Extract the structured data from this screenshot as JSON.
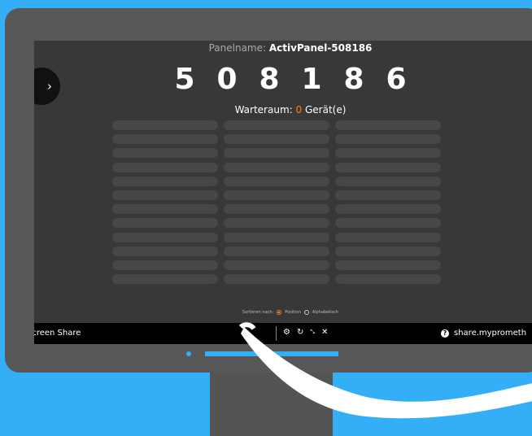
{
  "panel": {
    "label": "Panelname:",
    "name": "ActivPanel-508186",
    "digits": [
      "5",
      "0",
      "8",
      "1",
      "8",
      "6"
    ],
    "waiting_label": "Warteraum:",
    "waiting_count": "0",
    "waiting_unit": "Gerät(e)"
  },
  "sort": {
    "label": "Sortieren nach:",
    "options": [
      "Position",
      "Alphabetisch"
    ],
    "selected": "Position"
  },
  "taskbar": {
    "app_title": "Screen Share",
    "controls": [
      "gear-icon",
      "refresh-icon",
      "shrink-icon",
      "close-icon"
    ],
    "url": "share.myprometh"
  },
  "colors": {
    "background": "#33aef7",
    "accent": "#ff7d21",
    "screen": "#383838"
  }
}
